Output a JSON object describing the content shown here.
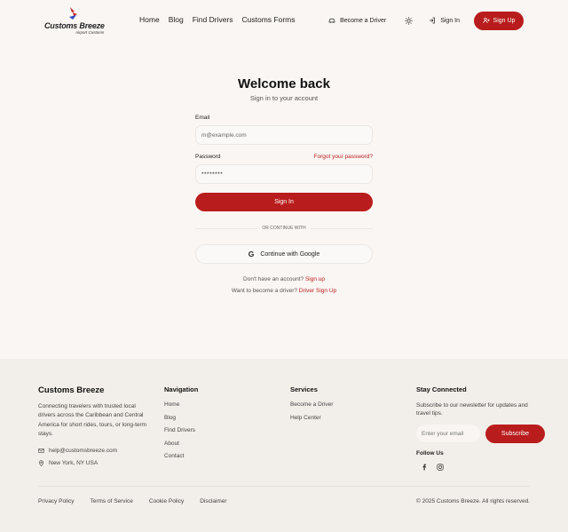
{
  "brand": {
    "name": "Customs Breeze",
    "tagline": "Airport Customs",
    "colors": {
      "accent": "#b91c1c",
      "background": "#faf6f3",
      "footer_bg": "#f2eeea"
    }
  },
  "header": {
    "nav": [
      "Home",
      "Blog",
      "Find Drivers",
      "Customs Forms"
    ],
    "become_driver": "Become a Driver",
    "theme_icon": "sun-icon",
    "sign_in": "Sign In",
    "sign_up": "Sign Up"
  },
  "auth": {
    "title": "Welcome back",
    "subtitle": "Sign in to your account",
    "email_label": "Email",
    "email_placeholder": "m@example.com",
    "password_label": "Password",
    "forgot": "Forgot your password?",
    "password_value": "********",
    "submit": "Sign In",
    "divider": "OR CONTINUE WITH",
    "google": "Continue with Google",
    "no_account": "Don't have an account?",
    "sign_up_link": "Sign up",
    "driver_prompt": "Want to become a driver?",
    "driver_link": "Driver Sign Up"
  },
  "footer": {
    "brand_title": "Customs Breeze",
    "description": "Connecting travelers with trusted local drivers across the Caribbean and Central America for short rides, tours, or long-term stays.",
    "email": "help@customsbreeze.com",
    "location": "New York, NY USA",
    "navigation": {
      "title": "Navigation",
      "links": [
        "Home",
        "Blog",
        "Find Drivers",
        "About",
        "Contact"
      ]
    },
    "services": {
      "title": "Services",
      "links": [
        "Become a Driver",
        "Help Center"
      ]
    },
    "stay": {
      "title": "Stay Connected",
      "text": "Subscribe to our newsletter for updates and travel tips.",
      "placeholder": "Enter your email",
      "button": "Subscribe",
      "follow": "Follow Us"
    },
    "legal": [
      "Privacy Policy",
      "Terms of Service",
      "Cookie Policy",
      "Disclaimer"
    ],
    "copyright": "© 2025 Customs Breeze. All rights reserved."
  }
}
